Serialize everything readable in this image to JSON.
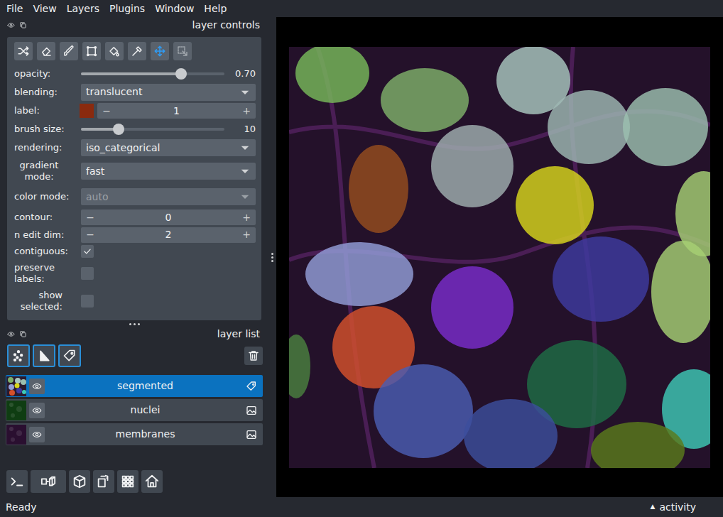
{
  "menu": [
    "File",
    "View",
    "Layers",
    "Plugins",
    "Window",
    "Help"
  ],
  "layer_controls": {
    "title": "layer controls",
    "tools": [
      {
        "selected": false
      },
      {
        "selected": false
      },
      {
        "selected": false
      },
      {
        "selected": false
      },
      {
        "selected": false
      },
      {
        "selected": false
      },
      {
        "selected": true
      },
      {
        "selected": false
      }
    ],
    "rows": [
      {
        "kind": "slider",
        "label": "opacity:",
        "level": 0.7,
        "reading": "0.70"
      },
      {
        "kind": "dropdown",
        "label": "blending:",
        "value": "translucent",
        "disabled": false
      },
      {
        "kind": "labelspin",
        "label": "label:",
        "value": "1",
        "color": "#8a2a0e",
        "minus": "−",
        "plus": "+"
      },
      {
        "kind": "slider",
        "label": "brush size:",
        "level": 0.26,
        "reading": "10"
      },
      {
        "kind": "dropdown",
        "label": "rendering:",
        "value": "iso_categorical",
        "disabled": false
      },
      {
        "kind": "dropdown",
        "label": "gradient mode:",
        "value": "fast",
        "disabled": false
      },
      {
        "kind": "dropdown",
        "label": "color mode:",
        "value": "auto",
        "disabled": true
      },
      {
        "kind": "spinbox",
        "label": "contour:",
        "value": "0",
        "minus": "−",
        "plus": "+"
      },
      {
        "kind": "spinbox",
        "label": "n edit dim:",
        "value": "2",
        "minus": "−",
        "plus": "+"
      },
      {
        "kind": "checkbox",
        "label": "contiguous:",
        "checked": true
      },
      {
        "kind": "checkbox",
        "label": "preserve labels:",
        "checked": false
      },
      {
        "kind": "checkbox",
        "label": "show selected:",
        "checked": false
      }
    ]
  },
  "layer_list": {
    "title": "layer list",
    "layers": [
      {
        "name": "segmented",
        "kind": "labels",
        "visible": true,
        "selected": true,
        "color": "#2a1a2e"
      },
      {
        "name": "nuclei",
        "kind": "image",
        "visible": true,
        "selected": false,
        "color": "#0f3d12"
      },
      {
        "name": "membranes",
        "kind": "image",
        "visible": true,
        "selected": false,
        "color": "#2a0f30"
      }
    ]
  },
  "status_bar": {
    "message": "Ready",
    "activity_icon": "▲",
    "activity": "activity"
  }
}
